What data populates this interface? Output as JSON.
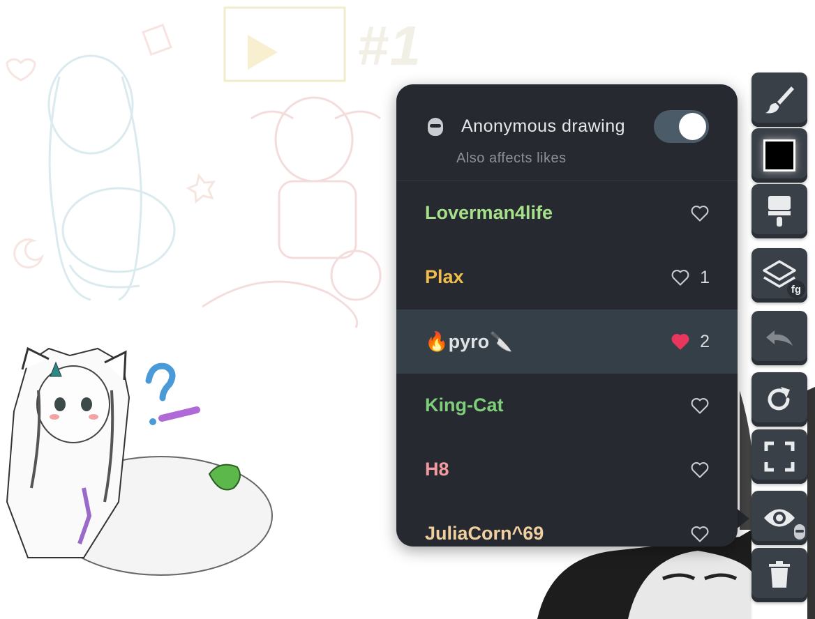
{
  "anonymous": {
    "title": "Anonymous drawing",
    "subtitle": "Also affects likes",
    "enabled": true
  },
  "users": [
    {
      "name": "Loverman4life",
      "color": "#a6e08a",
      "likes": "",
      "liked": false
    },
    {
      "name": "Plax",
      "color": "#f0bd4c",
      "likes": "1",
      "liked": false
    },
    {
      "name": "🔥pyro🔪",
      "color": "#e0e2e4",
      "likes": "2",
      "liked": true
    },
    {
      "name": "King-Cat",
      "color": "#7fcf7a",
      "likes": "",
      "liked": false
    },
    {
      "name": "H8",
      "color": "#f29a9f",
      "likes": "",
      "liked": false
    },
    {
      "name": "JuliaCorn^69",
      "color": "#f0cfa0",
      "likes": "",
      "liked": false
    }
  ],
  "toolbar": {
    "tools": [
      {
        "name": "brush-tool",
        "icon": "brush-icon"
      },
      {
        "name": "color-picker",
        "icon": "color-swatch",
        "color": "#000000"
      },
      {
        "name": "fill-tool",
        "icon": "paint-roller-icon"
      },
      {
        "name": "layer-toggle",
        "icon": "layers-icon",
        "badge": "fg"
      },
      {
        "name": "undo",
        "icon": "undo-icon"
      },
      {
        "name": "redo",
        "icon": "redo-icon"
      },
      {
        "name": "fullscreen",
        "icon": "expand-icon"
      },
      {
        "name": "visibility",
        "icon": "eye-icon"
      },
      {
        "name": "clear",
        "icon": "trash-icon"
      }
    ]
  },
  "canvas": {
    "hash_text": "#1"
  },
  "colors": {
    "panel_bg": "#262a30",
    "active_row": "#353f47",
    "heart_liked": "#e8365d",
    "heart_outline": "#c9ccd0",
    "toolbar_btn": "#3a4047"
  }
}
